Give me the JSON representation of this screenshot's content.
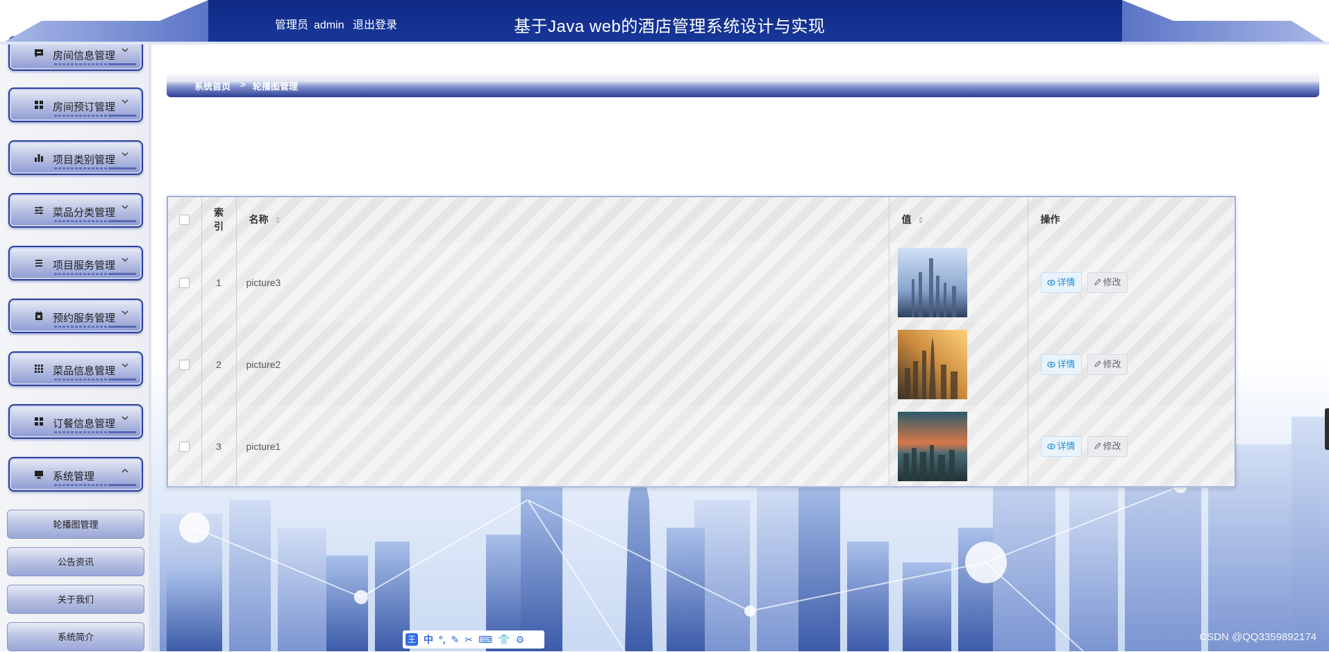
{
  "header": {
    "user_role": "管理员",
    "username": "admin",
    "logout": "退出登录",
    "title": "基于Java web的酒店管理系统设计与实现",
    "colors": {
      "primary": "#14318f",
      "light": "#6c85d0"
    }
  },
  "sidebar": {
    "menus": [
      {
        "label": "房间信息管理",
        "icon": "comment-icon",
        "expanded": false
      },
      {
        "label": "房间预订管理",
        "icon": "grid-icon",
        "expanded": false
      },
      {
        "label": "项目类别管理",
        "icon": "bar-chart-icon",
        "expanded": false
      },
      {
        "label": "菜品分类管理",
        "icon": "sliders-icon",
        "expanded": false
      },
      {
        "label": "项目服务管理",
        "icon": "list-icon",
        "expanded": false
      },
      {
        "label": "预约服务管理",
        "icon": "calendar-x-icon",
        "expanded": false
      },
      {
        "label": "菜品信息管理",
        "icon": "grid-3x3-icon",
        "expanded": false
      },
      {
        "label": "订餐信息管理",
        "icon": "grid-icon",
        "expanded": false
      },
      {
        "label": "系统管理",
        "icon": "monitor-icon",
        "expanded": true
      }
    ],
    "submenu": [
      "轮播图管理",
      "公告资讯",
      "关于我们",
      "系统简介"
    ]
  },
  "breadcrumb": {
    "home": "系统首页",
    "separator": ">",
    "current": "轮播图管理"
  },
  "table": {
    "headers": {
      "index": "索引",
      "name": "名称",
      "value": "值",
      "actions": "操作"
    },
    "rows": [
      {
        "index": "1",
        "name": "picture3"
      },
      {
        "index": "2",
        "name": "picture2"
      },
      {
        "index": "3",
        "name": "picture1"
      }
    ],
    "detail_label": "详情",
    "edit_label": "修改"
  },
  "ime": {
    "label": "王",
    "lang": "中"
  },
  "watermark": "CSDN @QQ3359892174"
}
